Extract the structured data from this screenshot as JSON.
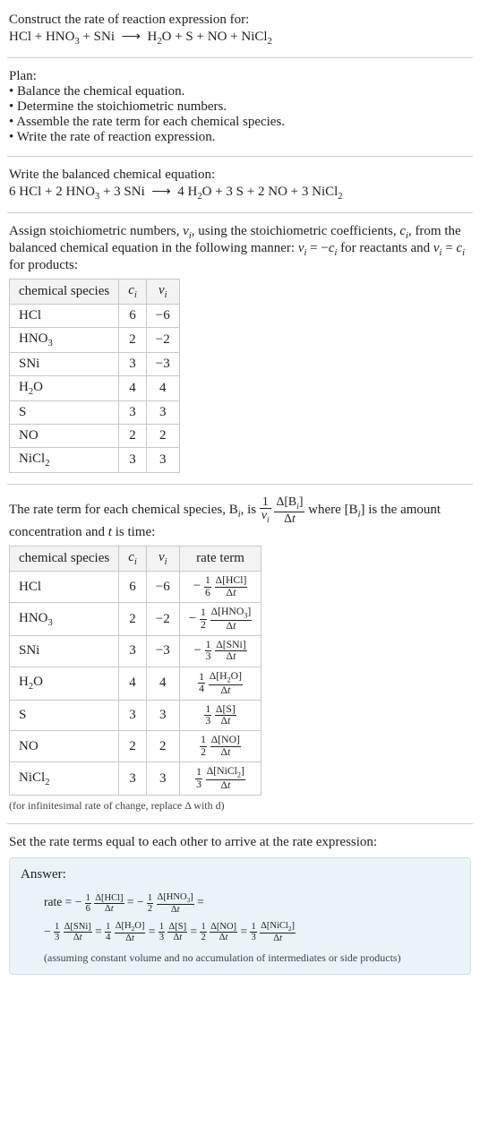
{
  "prompt": {
    "title": "Construct the rate of reaction expression for:",
    "equation_html": "HCl + HNO<sub>3</sub> + SNi &nbsp;<span class='arrow'>⟶</span>&nbsp; H<sub>2</sub>O + S + NO + NiCl<sub>2</sub>"
  },
  "plan": {
    "label": "Plan:",
    "items": [
      "Balance the chemical equation.",
      "Determine the stoichiometric numbers.",
      "Assemble the rate term for each chemical species.",
      "Write the rate of reaction expression."
    ]
  },
  "balanced": {
    "label": "Write the balanced chemical equation:",
    "equation_html": "6 HCl + 2 HNO<sub>3</sub> + 3 SNi &nbsp;<span class='arrow'>⟶</span>&nbsp; 4 H<sub>2</sub>O + 3 S + 2 NO + 3 NiCl<sub>2</sub>"
  },
  "assign": {
    "text_html": "Assign stoichiometric numbers, <span class='ital'>ν<sub>i</sub></span>, using the stoichiometric coefficients, <span class='ital'>c<sub>i</sub></span>, from the balanced chemical equation in the following manner: <span class='ital'>ν<sub>i</sub></span> = −<span class='ital'>c<sub>i</sub></span> for reactants and <span class='ital'>ν<sub>i</sub></span> = <span class='ital'>c<sub>i</sub></span> for products:",
    "headers": {
      "species": "chemical species",
      "ci_html": "<span class='ital'>c<sub>i</sub></span>",
      "vi_html": "<span class='ital'>ν<sub>i</sub></span>"
    },
    "rows": [
      {
        "species_html": "HCl",
        "ci": "6",
        "vi": "−6"
      },
      {
        "species_html": "HNO<sub>3</sub>",
        "ci": "2",
        "vi": "−2"
      },
      {
        "species_html": "SNi",
        "ci": "3",
        "vi": "−3"
      },
      {
        "species_html": "H<sub>2</sub>O",
        "ci": "4",
        "vi": "4"
      },
      {
        "species_html": "S",
        "ci": "3",
        "vi": "3"
      },
      {
        "species_html": "NO",
        "ci": "2",
        "vi": "2"
      },
      {
        "species_html": "NiCl<sub>2</sub>",
        "ci": "3",
        "vi": "3"
      }
    ]
  },
  "rate_intro": {
    "text_before_html": "The rate term for each chemical species, B<sub><span class='ital'>i</span></sub>, is ",
    "formula_html": "<span class='frac'><span class='num'>1</span><span class='den'><span class='ital'>ν<sub>i</sub></span></span></span> <span class='frac'><span class='num'>Δ[B<sub><span class='ital'>i</span></sub>]</span><span class='den'>Δ<span class='ital'>t</span></span></span>",
    "text_after_html": " where [B<sub><span class='ital'>i</span></sub>] is the amount concentration and <span class='ital'>t</span> is time:"
  },
  "rate_table": {
    "headers": {
      "species": "chemical species",
      "ci_html": "<span class='ital'>c<sub>i</sub></span>",
      "vi_html": "<span class='ital'>ν<sub>i</sub></span>",
      "rate": "rate term"
    },
    "rows": [
      {
        "species_html": "HCl",
        "ci": "6",
        "vi": "−6",
        "rate_html": "− <span class='frac smallfrac'><span class='num'>1</span><span class='den'>6</span></span> <span class='frac smallfrac'><span class='num'>Δ[HCl]</span><span class='den'>Δ<span class='ital'>t</span></span></span>"
      },
      {
        "species_html": "HNO<sub>3</sub>",
        "ci": "2",
        "vi": "−2",
        "rate_html": "− <span class='frac smallfrac'><span class='num'>1</span><span class='den'>2</span></span> <span class='frac smallfrac'><span class='num'>Δ[HNO<sub>3</sub>]</span><span class='den'>Δ<span class='ital'>t</span></span></span>"
      },
      {
        "species_html": "SNi",
        "ci": "3",
        "vi": "−3",
        "rate_html": "− <span class='frac smallfrac'><span class='num'>1</span><span class='den'>3</span></span> <span class='frac smallfrac'><span class='num'>Δ[SNi]</span><span class='den'>Δ<span class='ital'>t</span></span></span>"
      },
      {
        "species_html": "H<sub>2</sub>O",
        "ci": "4",
        "vi": "4",
        "rate_html": "<span class='frac smallfrac'><span class='num'>1</span><span class='den'>4</span></span> <span class='frac smallfrac'><span class='num'>Δ[H<sub>2</sub>O]</span><span class='den'>Δ<span class='ital'>t</span></span></span>"
      },
      {
        "species_html": "S",
        "ci": "3",
        "vi": "3",
        "rate_html": "<span class='frac smallfrac'><span class='num'>1</span><span class='den'>3</span></span> <span class='frac smallfrac'><span class='num'>Δ[S]</span><span class='den'>Δ<span class='ital'>t</span></span></span>"
      },
      {
        "species_html": "NO",
        "ci": "2",
        "vi": "2",
        "rate_html": "<span class='frac smallfrac'><span class='num'>1</span><span class='den'>2</span></span> <span class='frac smallfrac'><span class='num'>Δ[NO]</span><span class='den'>Δ<span class='ital'>t</span></span></span>"
      },
      {
        "species_html": "NiCl<sub>2</sub>",
        "ci": "3",
        "vi": "3",
        "rate_html": "<span class='frac smallfrac'><span class='num'>1</span><span class='den'>3</span></span> <span class='frac smallfrac'><span class='num'>Δ[NiCl<sub>2</sub>]</span><span class='den'>Δ<span class='ital'>t</span></span></span>"
      }
    ],
    "footnote": "(for infinitesimal rate of change, replace Δ with d)"
  },
  "set_equal": "Set the rate terms equal to each other to arrive at the rate expression:",
  "answer": {
    "label": "Answer:",
    "expr_line1_html": "rate = − <span class='frac smallfrac'><span class='num'>1</span><span class='den'>6</span></span> <span class='frac smallfrac'><span class='num'>Δ[HCl]</span><span class='den'>Δ<span class='ital'>t</span></span></span> = − <span class='frac smallfrac'><span class='num'>1</span><span class='den'>2</span></span> <span class='frac smallfrac'><span class='num'>Δ[HNO<sub>3</sub>]</span><span class='den'>Δ<span class='ital'>t</span></span></span> =",
    "expr_line2_html": "− <span class='frac smallfrac'><span class='num'>1</span><span class='den'>3</span></span> <span class='frac smallfrac'><span class='num'>Δ[SNi]</span><span class='den'>Δ<span class='ital'>t</span></span></span> = <span class='frac smallfrac'><span class='num'>1</span><span class='den'>4</span></span> <span class='frac smallfrac'><span class='num'>Δ[H<sub>2</sub>O]</span><span class='den'>Δ<span class='ital'>t</span></span></span> = <span class='frac smallfrac'><span class='num'>1</span><span class='den'>3</span></span> <span class='frac smallfrac'><span class='num'>Δ[S]</span><span class='den'>Δ<span class='ital'>t</span></span></span> = <span class='frac smallfrac'><span class='num'>1</span><span class='den'>2</span></span> <span class='frac smallfrac'><span class='num'>Δ[NO]</span><span class='den'>Δ<span class='ital'>t</span></span></span> = <span class='frac smallfrac'><span class='num'>1</span><span class='den'>3</span></span> <span class='frac smallfrac'><span class='num'>Δ[NiCl<sub>2</sub>]</span><span class='den'>Δ<span class='ital'>t</span></span></span>",
    "assume": "(assuming constant volume and no accumulation of intermediates or side products)"
  }
}
